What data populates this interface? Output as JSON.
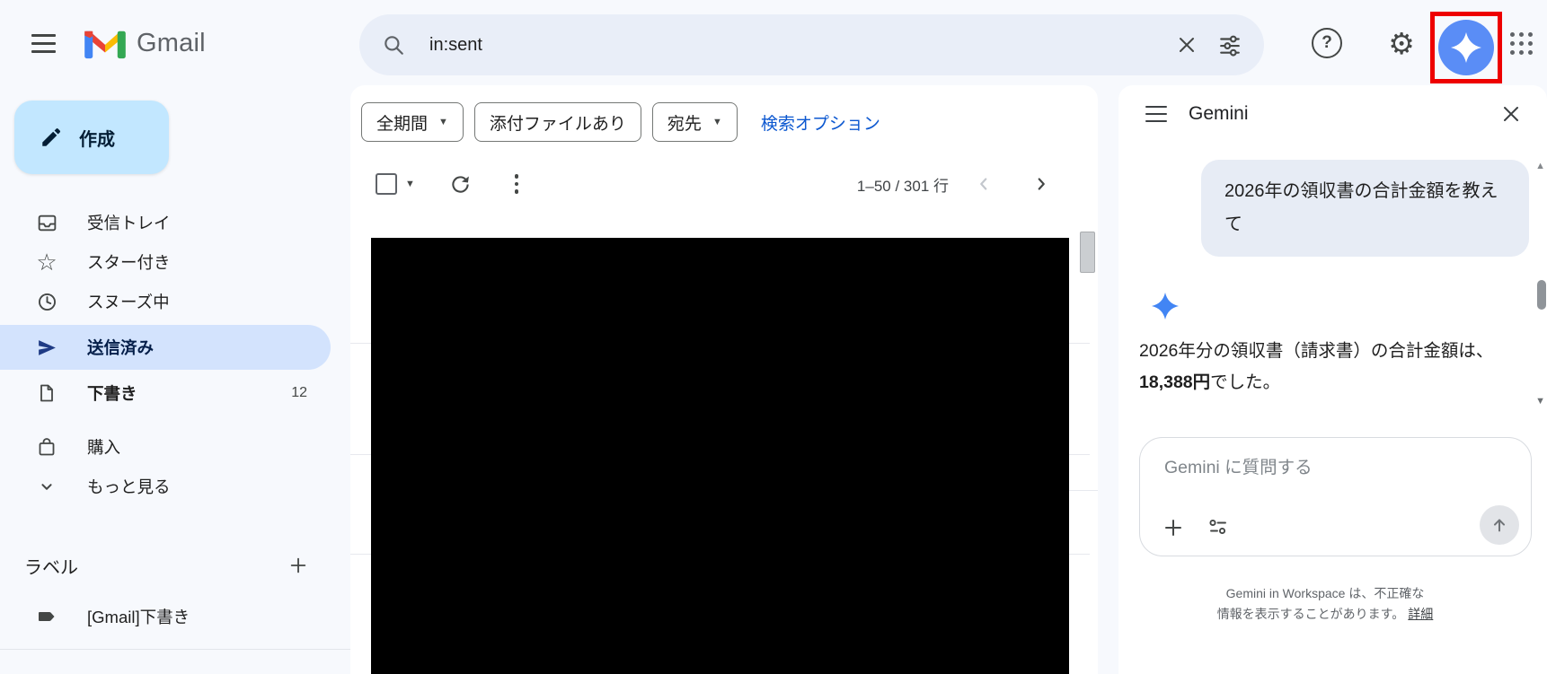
{
  "topbar": {
    "gmail_label": "Gmail",
    "search_value": "in:sent"
  },
  "sidebar": {
    "compose_label": "作成",
    "items": [
      {
        "label": "受信トレイ"
      },
      {
        "label": "スター付き"
      },
      {
        "label": "スヌーズ中"
      },
      {
        "label": "送信済み",
        "selected": true
      },
      {
        "label": "下書き",
        "count": "12"
      },
      {
        "label": "購入"
      },
      {
        "label": "もっと見る"
      }
    ],
    "labels_heading": "ラベル",
    "label_items": [
      {
        "label": "[Gmail]下書き"
      }
    ]
  },
  "main": {
    "chips": [
      {
        "label": "全期間"
      },
      {
        "label": "添付ファイルあり"
      },
      {
        "label": "宛先"
      }
    ],
    "search_options_link": "検索オプション",
    "pagination": "1–50 / 301 行"
  },
  "gemini": {
    "title": "Gemini",
    "user_message": "2026年の領収書の合計金額を教えて",
    "response_prefix": "2026年分の領収書（請求書）の合計金額は、",
    "response_bold": "18,388円",
    "response_suffix": "でした。",
    "input_placeholder": "Gemini に質問する",
    "disclaimer_line1": "Gemini in Workspace は、不正確な",
    "disclaimer_line2": "情報を表示することがあります。",
    "disclaimer_link": "詳細"
  },
  "colors": {
    "accent_blue": "#0b57d0",
    "compose_bg": "#c2e7ff",
    "selected_item_bg": "#d3e3fd",
    "search_bg": "#e9eef8",
    "user_bubble_bg": "#e7ecf5",
    "gemini_button_blue": "#5a8df6",
    "highlight_red": "#ee0000"
  }
}
